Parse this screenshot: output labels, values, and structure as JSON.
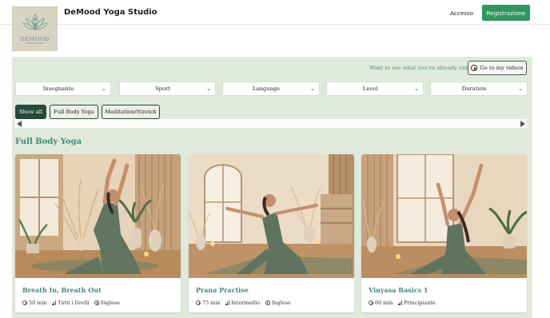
{
  "header": {
    "logo_word": "DEMOOD",
    "logo_sub": "YOGA STUDIO",
    "title": "DeMood Yoga Studio",
    "login_label": "Accesso",
    "register_label": "Registrazione",
    "accent_color": "#2e9660"
  },
  "library": {
    "unlock_question": "Want to see what you've already unlocked?",
    "my_videos_label": "Go to my videos",
    "filters": [
      {
        "label": "Insegnante"
      },
      {
        "label": "Sport"
      },
      {
        "label": "Language"
      },
      {
        "label": "Level"
      },
      {
        "label": "Duration"
      }
    ],
    "chips": [
      {
        "label": "Show all",
        "active": true
      },
      {
        "label": "Full Body Yoga",
        "active": false
      },
      {
        "label": "Meditation/Stretch",
        "active": false
      }
    ],
    "section_title": "Full Body Yoga",
    "videos": [
      {
        "title": "Breath In, Breath Out",
        "duration": "50 min",
        "level": "Tutti i livelli",
        "language": "Inglese",
        "thumbnail_icon": "yoga-pose-reach-photo"
      },
      {
        "title": "Prana Practise",
        "duration": "75 min",
        "level": "Intermedio",
        "language": "Inglese",
        "thumbnail_icon": "yoga-warrior-pose-photo"
      },
      {
        "title": "Vinyasa Basics 1",
        "duration": "60 min",
        "level": "Principiante",
        "language": "",
        "thumbnail_icon": "yoga-pose-reach-photo"
      }
    ]
  }
}
